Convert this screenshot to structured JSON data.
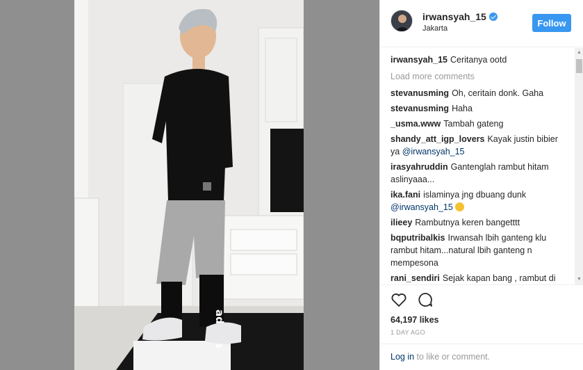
{
  "post": {
    "username": "irwansyah_15",
    "location": "Jakarta",
    "follow_label": "Follow",
    "caption_user": "irwansyah_15",
    "caption_text": "Ceritanya ootd",
    "load_more": "Load more comments",
    "likes": "64,197 likes",
    "time_ago": "1 DAY AGO",
    "login_link": "Log in",
    "login_text": " to like or comment."
  },
  "comments": [
    {
      "user": "stevanusming",
      "text": "Oh, ceritain donk. Gaha",
      "mention": ""
    },
    {
      "user": "stevanusming",
      "text": "Haha",
      "mention": ""
    },
    {
      "user": "_usma.www",
      "text": "Tambah gateng",
      "mention": ""
    },
    {
      "user": "shandy_att_igp_lovers",
      "text": "Kayak justin bibier ya",
      "mention": "@irwansyah_15"
    },
    {
      "user": "irasyahruddin",
      "text": "Ganteng­lah rambut hitam aslinyaaa...",
      "mention": ""
    },
    {
      "user": "ika.fani",
      "text": "islaminya jng dbuang dunk",
      "mention": "@irwansyah_15"
    },
    {
      "user": "ilieey",
      "text": "Rambutnya keren bangetttt",
      "mention": ""
    },
    {
      "user": "bqputribalkis",
      "text": "Irwansah lbih ganteng klu rambut hitam...natural lbih ganteng n mempesona",
      "mention": ""
    },
    {
      "user": "rani_sendiri",
      "text": "Sejak kapan bang , rambut di cat begitu.",
      "mention": ""
    }
  ],
  "icons": {
    "verified": "verified-badge-icon",
    "like": "heart-icon",
    "comment": "comment-bubble-icon"
  },
  "colors": {
    "follow_button": "#3897f0",
    "link": "#003569",
    "muted": "#999999",
    "backdrop": "#8f8f8f"
  }
}
